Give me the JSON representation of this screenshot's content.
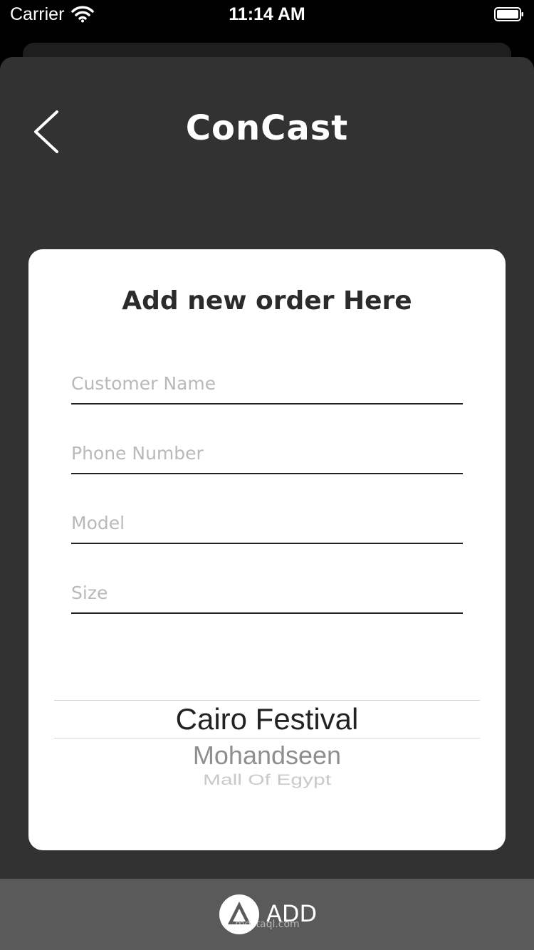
{
  "status_bar": {
    "carrier": "Carrier",
    "time": "11:14 AM"
  },
  "header": {
    "title": "ConCast"
  },
  "form": {
    "title": "Add new order Here",
    "fields": [
      {
        "placeholder": "Customer Name",
        "value": ""
      },
      {
        "placeholder": "Phone Number",
        "value": ""
      },
      {
        "placeholder": "Model",
        "value": ""
      },
      {
        "placeholder": "Size",
        "value": ""
      }
    ]
  },
  "picker": {
    "options": [
      "Cairo Festival",
      "Mohandseen",
      "Mall Of Egypt"
    ],
    "selected": "Cairo Festival"
  },
  "bottom_bar": {
    "add_label": "ADD",
    "watermark_text": "mostaql.com"
  },
  "icons": {
    "back": "chevron-left-icon",
    "wifi": "wifi-icon",
    "battery": "battery-icon"
  },
  "colors": {
    "background": "#000000",
    "sheet": "#323232",
    "card": "#ffffff",
    "bottom_bar": "#5a5a5a",
    "placeholder": "#b9b9b9"
  }
}
